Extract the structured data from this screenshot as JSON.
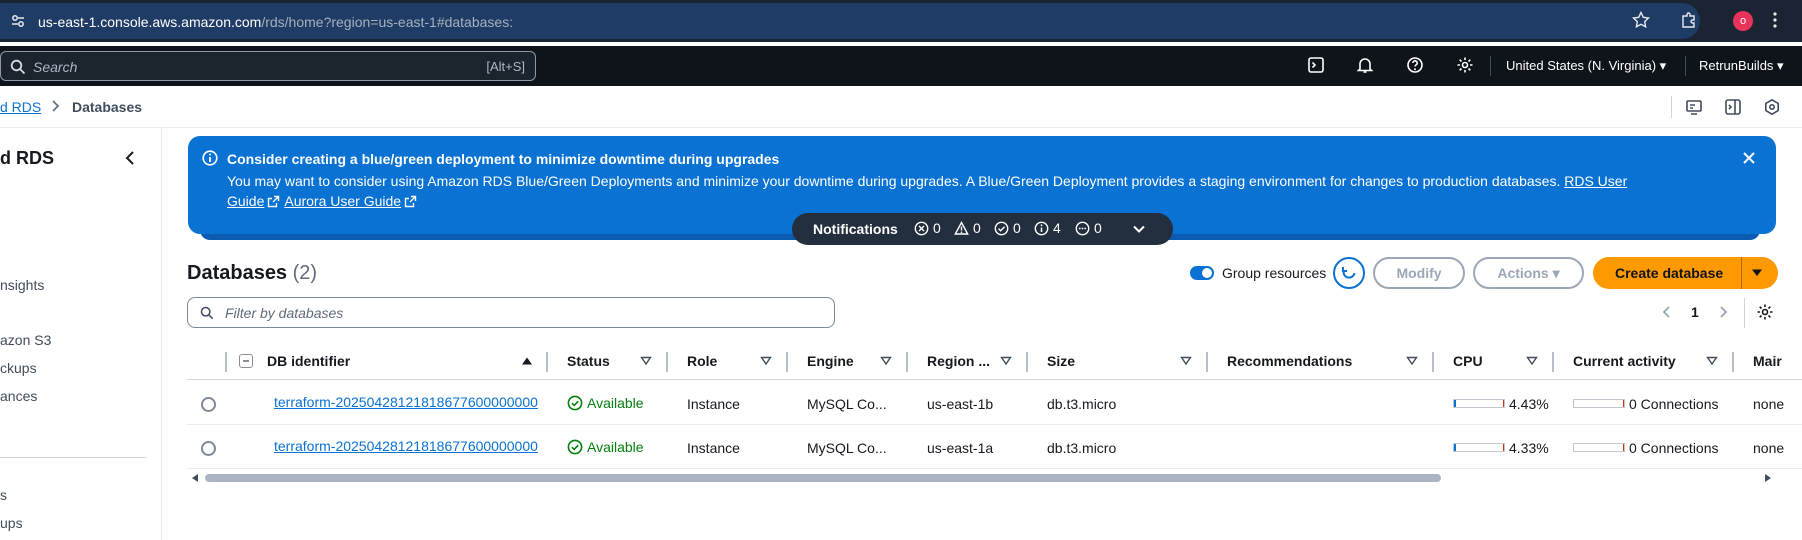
{
  "browser": {
    "url_host": "us-east-1.console.aws.amazon.com",
    "url_path": "/rds/home?region=us-east-1#databases:",
    "profile_initial": "o"
  },
  "topnav": {
    "search_placeholder": "Search",
    "search_shortcut": "[Alt+S]",
    "region": "United States (N. Virginia)",
    "account": "RetrunBuilds"
  },
  "breadcrumb": {
    "parent": "d RDS",
    "current": "Databases"
  },
  "sidebar": {
    "title": "d RDS",
    "items": [
      "nsights",
      "azon S3",
      "ckups",
      "ances",
      "s",
      "ups"
    ]
  },
  "flash": {
    "title": "Consider creating a blue/green deployment to minimize downtime during upgrades",
    "body": "You may want to consider using Amazon RDS Blue/Green Deployments and minimize your downtime during upgrades. A Blue/Green Deployment provides a staging environment for changes to production databases.",
    "link1_a": "RDS User",
    "link1_b": "Guide",
    "link2": "Aurora User Guide"
  },
  "notifications": {
    "title": "Notifications",
    "error": "0",
    "warning": "0",
    "success": "0",
    "info": "4",
    "pending": "0"
  },
  "databases": {
    "title": "Databases",
    "count": "(2)",
    "group_label": "Group resources",
    "modify_label": "Modify",
    "actions_label": "Actions",
    "create_label": "Create database",
    "filter_placeholder": "Filter by databases",
    "page": "1",
    "columns": {
      "identifier": "DB identifier",
      "status": "Status",
      "role": "Role",
      "engine": "Engine",
      "region": "Region ...",
      "size": "Size",
      "recommendations": "Recommendations",
      "cpu": "CPU",
      "activity": "Current activity",
      "maint": "Mair"
    },
    "rows": [
      {
        "identifier": "terraform-20250428121818677600000000",
        "status": "Available",
        "role": "Instance",
        "engine": "MySQL Co...",
        "region": "us-east-1b",
        "size": "db.t3.micro",
        "cpu": "4.43%",
        "cpu_fraction": 0.0443,
        "activity": "0 Connections",
        "maint": "none"
      },
      {
        "identifier": "terraform-20250428121818677600000000",
        "status": "Available",
        "role": "Instance",
        "engine": "MySQL Co...",
        "region": "us-east-1a",
        "size": "db.t3.micro",
        "cpu": "4.33%",
        "cpu_fraction": 0.0433,
        "activity": "0 Connections",
        "maint": "none"
      }
    ]
  },
  "colors": {
    "accent": "#0972d3",
    "primary_button": "#ff9900",
    "success": "#037f0c",
    "nav_bg": "#0f141a"
  }
}
